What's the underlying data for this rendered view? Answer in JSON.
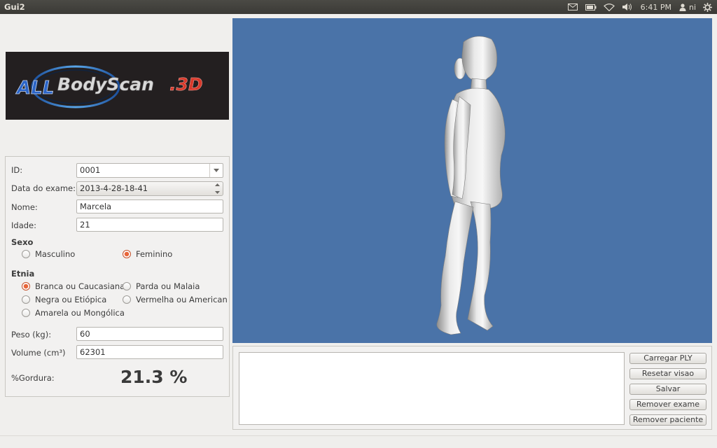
{
  "window": {
    "title": "Gui2"
  },
  "tray": {
    "clock": "6:41 PM",
    "user": "ni"
  },
  "logo": {
    "brand_left": "ALL",
    "brand_main": "BodyScan",
    "brand_suffix": ".3D"
  },
  "form": {
    "id_label": "ID:",
    "id_value": "0001",
    "date_label": "Data do exame:",
    "date_value": "2013-4-28-18-41",
    "name_label": "Nome:",
    "name_value": "Marcela",
    "age_label": "Idade:",
    "age_value": "21",
    "sex_section": "Sexo",
    "sex_options": [
      {
        "label": "Masculino",
        "checked": false
      },
      {
        "label": "Feminino",
        "checked": true
      }
    ],
    "ethnicity_section": "Etnia",
    "ethnicity_options": [
      {
        "label": "Branca ou Caucasiana",
        "checked": true
      },
      {
        "label": "Parda ou Malaia",
        "checked": false
      },
      {
        "label": "Negra ou Etiópica",
        "checked": false
      },
      {
        "label": "Vermelha ou American",
        "checked": false
      },
      {
        "label": "Amarela ou Mongólica",
        "checked": false
      }
    ],
    "weight_label": "Peso (kg):",
    "weight_value": "60",
    "volume_label": "Volume (cm³)",
    "volume_value": "62301",
    "fat_label": "%Gordura:",
    "fat_value": "21.3 %"
  },
  "buttons": {
    "load_ply": "Carregar PLY",
    "reset_view": "Resetar visao",
    "save": "Salvar",
    "remove_exam": "Remover exame",
    "remove_patient": "Remover paciente"
  },
  "colors": {
    "viewer_bg": "#4a73a8",
    "accent": "#e8663a",
    "topbar": "#3c3b37"
  }
}
